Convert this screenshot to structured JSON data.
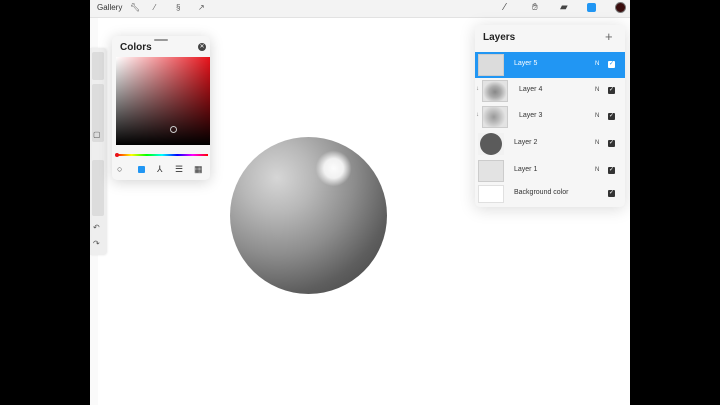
{
  "topbar": {
    "gallery_label": "Gallery",
    "tools_left": [
      "wrench-icon",
      "magic-wand-icon",
      "selection-icon",
      "transform-icon"
    ],
    "tools_right": [
      "brush-icon",
      "smudge-icon",
      "eraser-icon",
      "layers-icon"
    ],
    "current_color": "#3a0d0d"
  },
  "sidebar": {
    "modify_button_icon": "square-icon",
    "undo_icon": "undo-icon",
    "redo_icon": "redo-icon"
  },
  "colors_panel": {
    "title": "Colors",
    "selected_hue": "#e8131b",
    "tabs": [
      "disc-icon",
      "classic-icon",
      "harmony-icon",
      "value-icon",
      "palettes-icon"
    ],
    "active_tab": 1
  },
  "layers_panel": {
    "title": "Layers",
    "add_label": "+",
    "layers": [
      {
        "name": "Layer 5",
        "mode": "N",
        "selected": true,
        "clipped": false
      },
      {
        "name": "Layer 4",
        "mode": "N",
        "selected": false,
        "clipped": true
      },
      {
        "name": "Layer 3",
        "mode": "N",
        "selected": false,
        "clipped": true
      },
      {
        "name": "Layer 2",
        "mode": "N",
        "selected": false,
        "clipped": false
      },
      {
        "name": "Layer 1",
        "mode": "N",
        "selected": false,
        "clipped": false
      }
    ],
    "background": {
      "name": "Background color",
      "color": "#ffffff"
    }
  }
}
